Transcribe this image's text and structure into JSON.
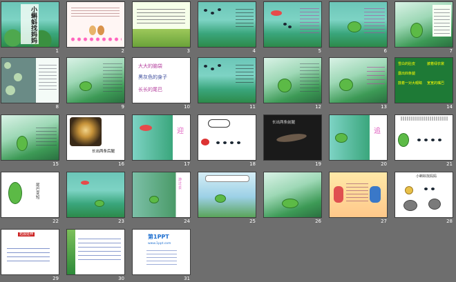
{
  "slide_numbers": [
    "1",
    "2",
    "3",
    "4",
    "5",
    "6",
    "7",
    "8",
    "9",
    "10",
    "11",
    "12",
    "13",
    "14",
    "15",
    "16",
    "17",
    "18",
    "19",
    "20",
    "21",
    "22",
    "23",
    "24",
    "25",
    "26",
    "27",
    "28",
    "29",
    "30",
    "31"
  ],
  "slide_text": {
    "s1_title": "小蝌蚪找妈妈",
    "s10_l1": "大大的脑袋",
    "s10_l2": "黑灰色的身子",
    "s10_l3": "长长的尾巴",
    "s14_c1": "雪白的肚皮",
    "s14_c2": "披着绿衣裳",
    "s14_c3": "露出四条腿",
    "s14_c4": "鼓着一对大眼睛",
    "s14_c5": "宽宽的嘴巴",
    "s16_caption": "长出两条后腿",
    "s17_mark": "迎",
    "s19_caption": "长出两条前腿",
    "s20_mark": "追",
    "s22_caption": "尾巴变短",
    "s24_mark": "游过去",
    "s28_title": "小蝌蚪找妈妈",
    "s29_title": "拓展延伸",
    "s31_logo": "第1PPT",
    "s31_url": "www.1ppt.com"
  }
}
